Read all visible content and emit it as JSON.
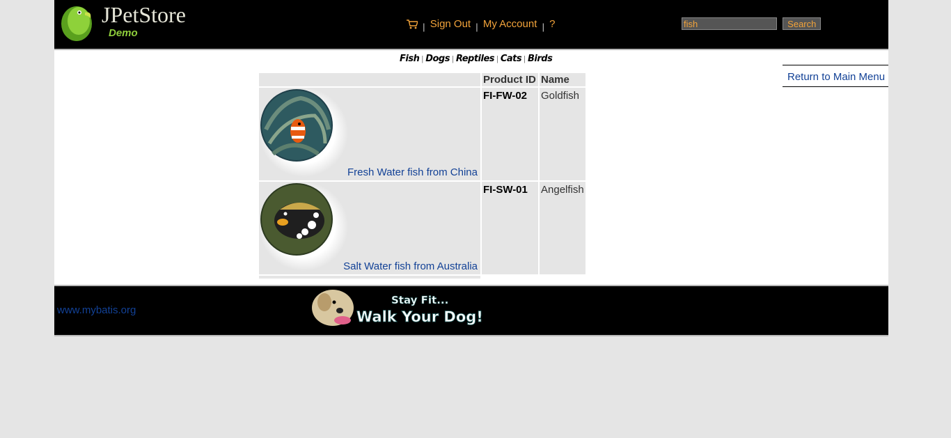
{
  "header": {
    "logo": {
      "title": "JPetStore",
      "subtitle": "Demo"
    },
    "menu": {
      "cart_icon": "cart-icon",
      "sign_out": "Sign Out",
      "my_account": "My Account",
      "help": "?",
      "separator": "|"
    },
    "search": {
      "value": "fish",
      "button": "Search"
    }
  },
  "quicklinks": {
    "separator": "|",
    "items": [
      "Fish",
      "Dogs",
      "Reptiles",
      "Cats",
      "Birds"
    ]
  },
  "back_link": "Return to Main Menu",
  "catalog": {
    "columns": [
      "",
      "Product ID",
      "Name"
    ],
    "rows": [
      {
        "image": "clownfish-image",
        "description": "Fresh Water fish from China",
        "product_id": "FI-FW-02",
        "name": "Goldfish"
      },
      {
        "image": "triggerfish-image",
        "description": "Salt Water fish from Australia",
        "product_id": "FI-SW-01",
        "name": "Angelfish"
      }
    ]
  },
  "footer": {
    "link": "www.mybatis.org",
    "banner": {
      "line1": "Stay Fit...",
      "line2": "Walk Your Dog!"
    }
  },
  "colors": {
    "header_bg": "#000000",
    "menu_link": "#f2a33a",
    "link": "#124196",
    "cell_bg": "#e5e5e5"
  }
}
